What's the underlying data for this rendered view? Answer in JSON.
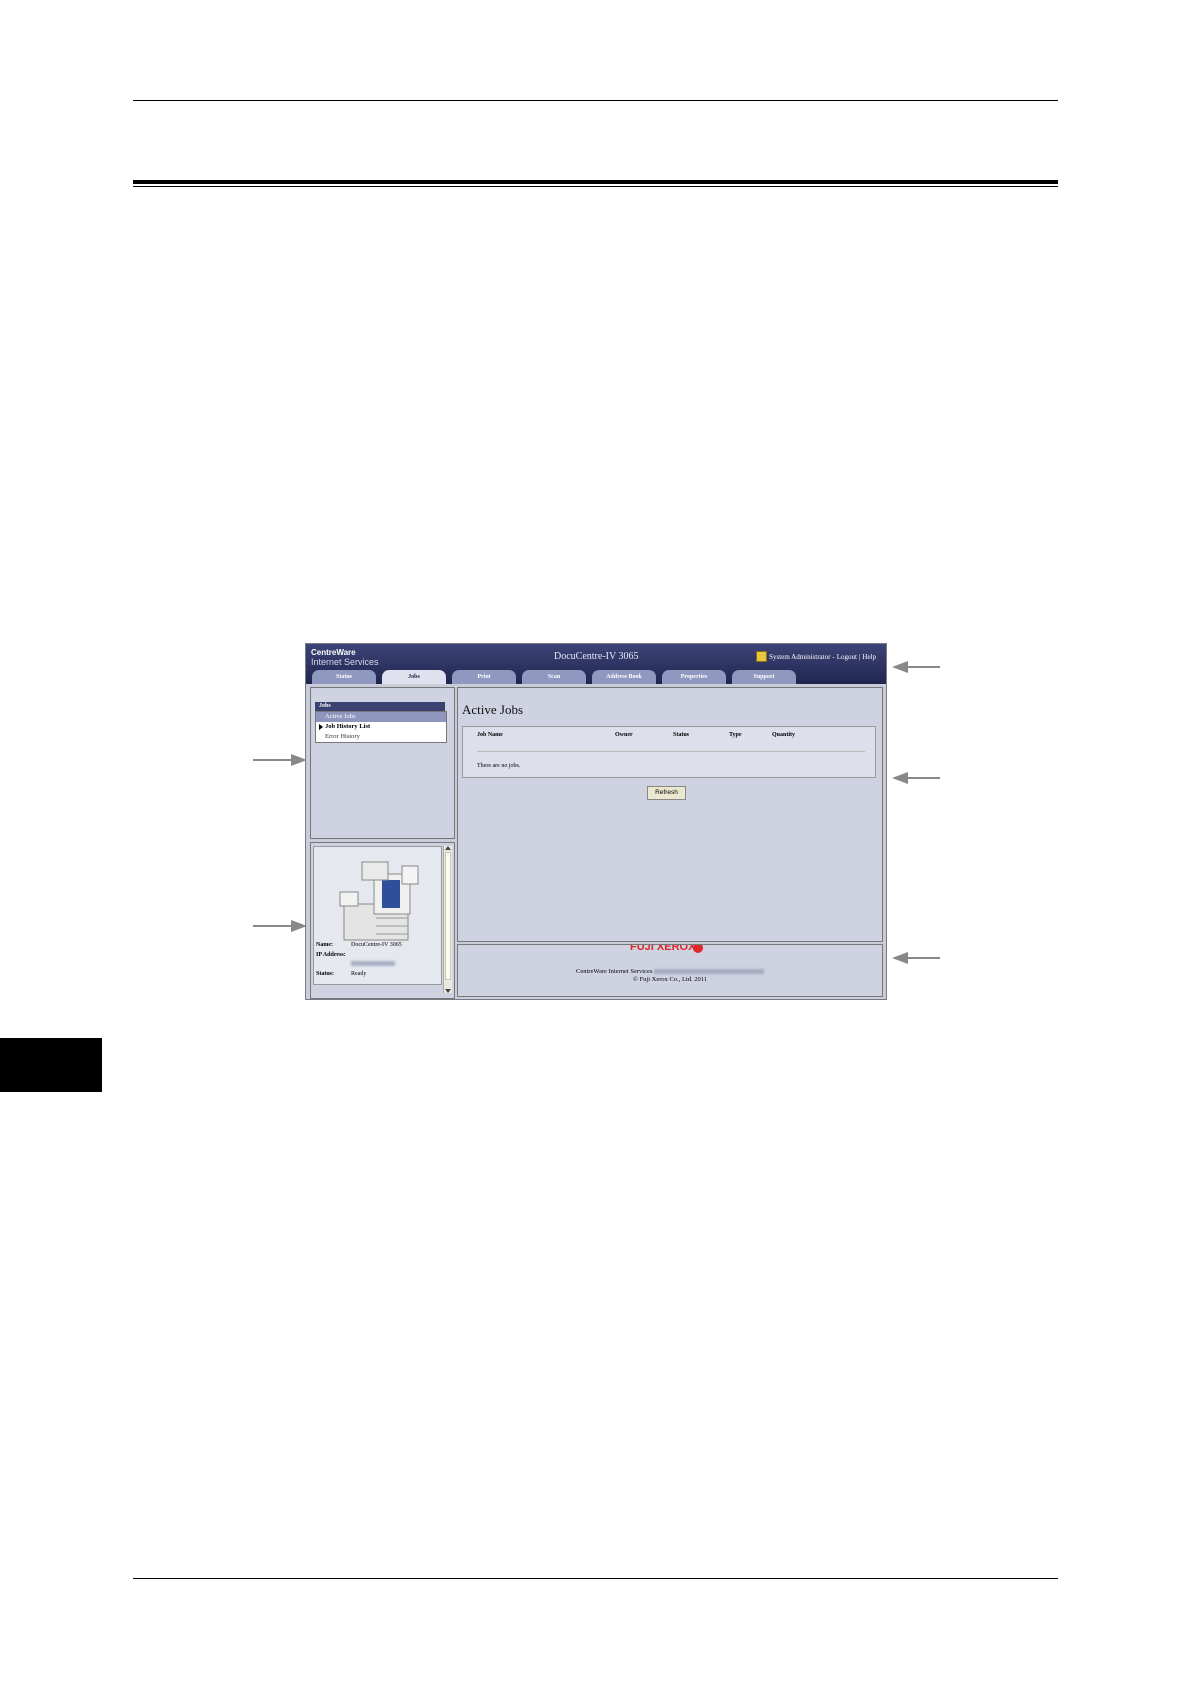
{
  "screenshot": {
    "brand_line1": "CentreWare",
    "brand_line2": "Internet Services",
    "device_title": "DocuCentre-IV 3065",
    "admin_user": "System Administrator",
    "logout": "Logout",
    "help": "Help",
    "tabs": [
      {
        "label": "Status"
      },
      {
        "label": "Jobs"
      },
      {
        "label": "Print"
      },
      {
        "label": "Scan"
      },
      {
        "label": "Address Book"
      },
      {
        "label": "Properties"
      },
      {
        "label": "Support"
      }
    ],
    "nav": {
      "header": "Jobs",
      "items": [
        {
          "label": "Active Jobs"
        },
        {
          "label": "Job History List"
        },
        {
          "label": "Error History"
        }
      ]
    },
    "device_info": {
      "name_label": "Name:",
      "name_value": "DocuCentre-IV 3065",
      "ip_label": "IP Address:",
      "status_label": "Status:",
      "status_value": "Ready"
    },
    "main": {
      "title": "Active Jobs",
      "columns": [
        "Job Name",
        "Owner",
        "Status",
        "Type",
        "Quantity"
      ],
      "empty_message": "There are no jobs.",
      "refresh_button": "Refresh"
    },
    "footer": {
      "logo": "FUJI XEROX",
      "product": "CentreWare Internet Services",
      "copyright": "© Fuji Xerox Co., Ltd. 2011"
    }
  }
}
